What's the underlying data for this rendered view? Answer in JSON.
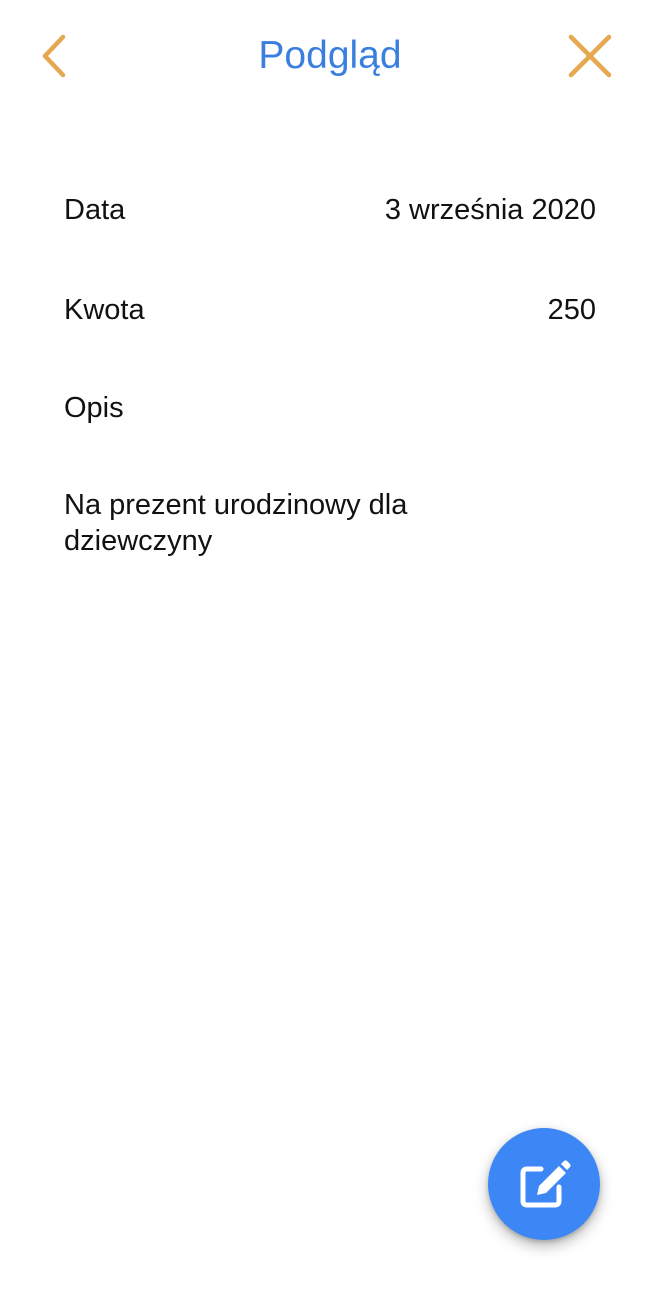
{
  "header": {
    "title": "Podgląd",
    "back_icon": "chevron-left-icon",
    "close_icon": "close-icon",
    "accent_color": "#e5a84f",
    "title_color": "#3a7fe0"
  },
  "details": {
    "date_label": "Data",
    "date_value": "3 września 2020",
    "amount_label": "Kwota",
    "amount_value": "250",
    "description_label": "Opis",
    "description_value": "Na prezent urodzinowy dla dziewczyny"
  },
  "fab": {
    "icon": "edit-icon",
    "color": "#3d86f5"
  }
}
